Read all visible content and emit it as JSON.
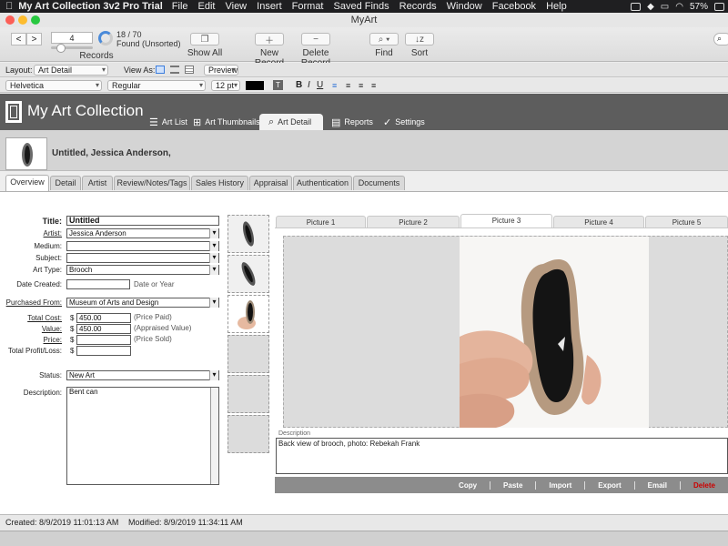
{
  "menubar": {
    "app_name": "My Art Collection 3v2 Pro Trial",
    "items": [
      "File",
      "Edit",
      "View",
      "Insert",
      "Format",
      "Saved Finds",
      "Records",
      "Window",
      "Facebook",
      "Help"
    ],
    "battery": "57%"
  },
  "window": {
    "title": "MyArt"
  },
  "toolbar": {
    "record_number": "4",
    "found_count": "18 / 70",
    "found_status": "Found (Unsorted)",
    "records_label": "Records",
    "show_all_label": "Show All",
    "new_record_label": "New Record",
    "delete_record_label": "Delete Record",
    "find_label": "Find",
    "sort_label": "Sort"
  },
  "layoutbar": {
    "layout_label": "Layout:",
    "layout_value": "Art Detail",
    "view_as_label": "View As:",
    "preview_label": "Preview"
  },
  "formatbar": {
    "font": "Helvetica",
    "style": "Regular",
    "size": "12 pt",
    "text_color": "#000000"
  },
  "app": {
    "title": "My Art Collection",
    "nav": [
      "Art List",
      "Art Thumbnails",
      "Art Detail",
      "Reports",
      "Settings"
    ]
  },
  "record": {
    "header_title": "Untitled, Jessica Anderson,"
  },
  "tabs": [
    "Overview",
    "Detail",
    "Artist",
    "Review/Notes/Tags",
    "Sales History",
    "Appraisal",
    "Authentication",
    "Documents"
  ],
  "form": {
    "title_label": "Title:",
    "title_value": "Untitled",
    "artist_label": "Artist:",
    "artist_value": "Jessica Anderson",
    "medium_label": "Medium:",
    "subject_label": "Subject:",
    "art_type_label": "Art Type:",
    "art_type_value": "Brooch",
    "date_created_label": "Date Created:",
    "date_hint": "Date or Year",
    "purchased_from_label": "Purchased From:",
    "purchased_from_value": "Museum of Arts and Design",
    "total_cost_label": "Total Cost:",
    "total_cost_value": "450.00",
    "total_cost_hint": "(Price Paid)",
    "value_label": "Value:",
    "value_value": "450.00",
    "value_hint": "(Appraised Value)",
    "price_label": "Price:",
    "price_hint": "(Price Sold)",
    "profit_label": "Total Profit/Loss:",
    "currency": "$",
    "status_label": "Status:",
    "status_value": "New Art",
    "description_label": "Description:",
    "description_value": "Bent can"
  },
  "pictures": {
    "tabs": [
      "Picture 1",
      "Picture 2",
      "Picture 3",
      "Picture 4",
      "Picture 5"
    ],
    "description_label": "Description",
    "description_value": "Back view of brooch, photo: Rebekah Frank",
    "actions": [
      "Copy",
      "Paste",
      "Import",
      "Export",
      "Email",
      "Delete"
    ]
  },
  "status": {
    "created": "Created: 8/9/2019 11:01:13 AM",
    "modified": "Modified: 8/9/2019 11:34:11 AM"
  }
}
